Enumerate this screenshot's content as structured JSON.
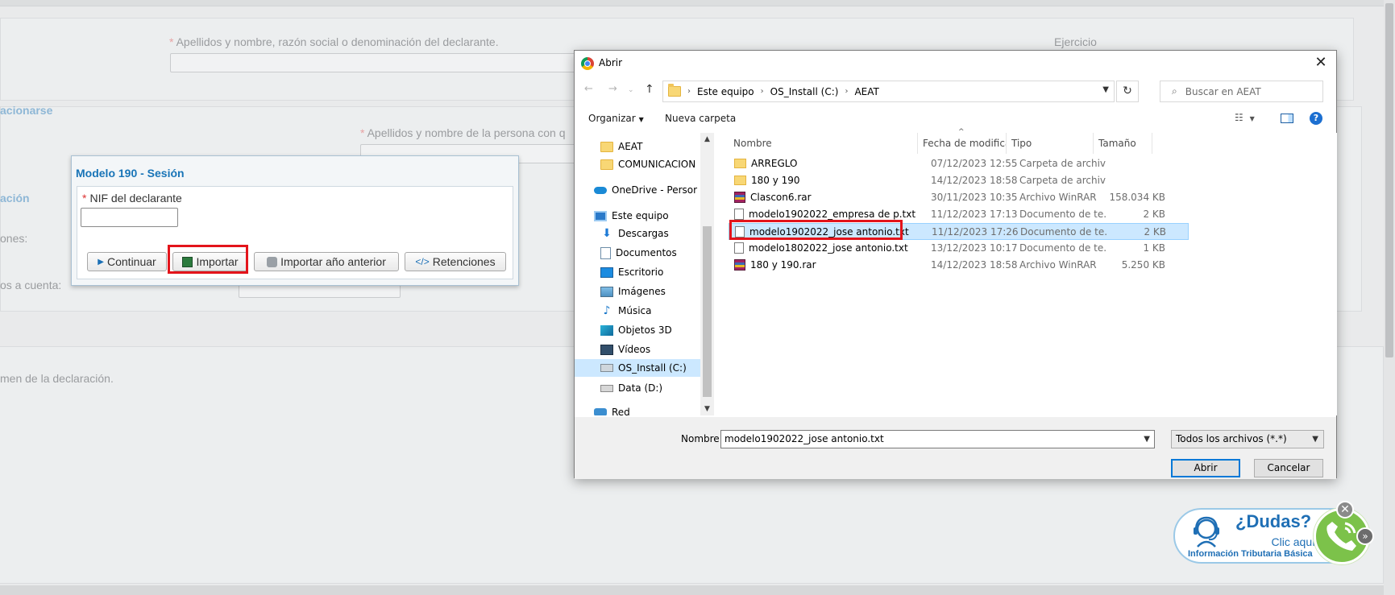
{
  "background": {
    "declarante_label": "Apellidos y nombre, razón social o denominación del declarante.",
    "ejercicio_label": "Ejercicio",
    "section_relacionarse": "acionarse",
    "persona_label": "Apellidos y nombre de la persona con q",
    "section_cion": "ación",
    "label_ones": "ones:",
    "label_cuenta": "os a cuenta:",
    "resumen_text": "men de la declaración."
  },
  "session": {
    "title": "Modelo 190 - Sesión",
    "nif_label": "NIF del declarante",
    "nif_value": "",
    "buttons": {
      "continuar": "Continuar",
      "importar": "Importar",
      "importar_anterior": "Importar año anterior",
      "retenciones": "Retenciones"
    }
  },
  "dialog": {
    "title": "Abrir",
    "address": [
      "Este equipo",
      "OS_Install (C:)",
      "AEAT"
    ],
    "search_placeholder": "Buscar en AEAT",
    "toolbar": {
      "organize": "Organizar",
      "new_folder": "Nueva carpeta"
    },
    "nav_items": [
      {
        "label": "AEAT",
        "icon": "folder-icon"
      },
      {
        "label": "COMUNICACION",
        "icon": "folder-icon"
      },
      {
        "label": "OneDrive - Persor",
        "icon": "onedrive-icon"
      },
      {
        "label": "Este equipo",
        "icon": "computer-icon"
      },
      {
        "label": "Descargas",
        "icon": "downloads-icon"
      },
      {
        "label": "Documentos",
        "icon": "documents-icon"
      },
      {
        "label": "Escritorio",
        "icon": "desktop-icon"
      },
      {
        "label": "Imágenes",
        "icon": "pictures-icon"
      },
      {
        "label": "Música",
        "icon": "music-icon"
      },
      {
        "label": "Objetos 3D",
        "icon": "3d-objects-icon"
      },
      {
        "label": "Vídeos",
        "icon": "videos-icon"
      },
      {
        "label": "OS_Install (C:)",
        "icon": "drive-c-icon"
      },
      {
        "label": "Data (D:)",
        "icon": "drive-icon"
      },
      {
        "label": "Red",
        "icon": "network-icon"
      }
    ],
    "columns": [
      "Nombre",
      "Fecha de modifica...",
      "Tipo",
      "Tamaño"
    ],
    "files": [
      {
        "name": "ARREGLO",
        "date": "07/12/2023 12:55",
        "type": "Carpeta de archivos",
        "size": "",
        "icon": "folder-icon"
      },
      {
        "name": "180 y 190",
        "date": "14/12/2023 18:58",
        "type": "Carpeta de archivos",
        "size": "",
        "icon": "folder-icon"
      },
      {
        "name": "Clascon6.rar",
        "date": "30/11/2023 10:35",
        "type": "Archivo WinRAR",
        "size": "158.034 KB",
        "icon": "winrar-icon"
      },
      {
        "name": "modelo1902022_empresa de p.txt",
        "date": "11/12/2023 17:13",
        "type": "Documento de te...",
        "size": "2 KB",
        "icon": "text-file-icon"
      },
      {
        "name": "modelo1902022_jose antonio.txt",
        "date": "11/12/2023 17:26",
        "type": "Documento de te...",
        "size": "2 KB",
        "icon": "text-file-icon"
      },
      {
        "name": "modelo1802022_jose antonio.txt",
        "date": "13/12/2023 10:17",
        "type": "Documento de te...",
        "size": "1 KB",
        "icon": "text-file-icon"
      },
      {
        "name": "180 y 190.rar",
        "date": "14/12/2023 18:58",
        "type": "Archivo WinRAR",
        "size": "5.250 KB",
        "icon": "winrar-icon"
      }
    ],
    "selected_file_index": 4,
    "name_label": "Nombre:",
    "name_value": "modelo1902022_jose antonio.txt",
    "file_type": "Todos los archivos (*.*)",
    "open_button": "Abrir",
    "cancel_button": "Cancelar"
  },
  "help_widget": {
    "question": "¿Dudas?",
    "click": "Clic aquí",
    "info": "Información Tributaria Básica"
  },
  "colors": {
    "accent_blue": "#1874b7",
    "highlight_red": "#e3141b",
    "selection_blue": "#cce8ff",
    "phone_green": "#7cc24a"
  }
}
